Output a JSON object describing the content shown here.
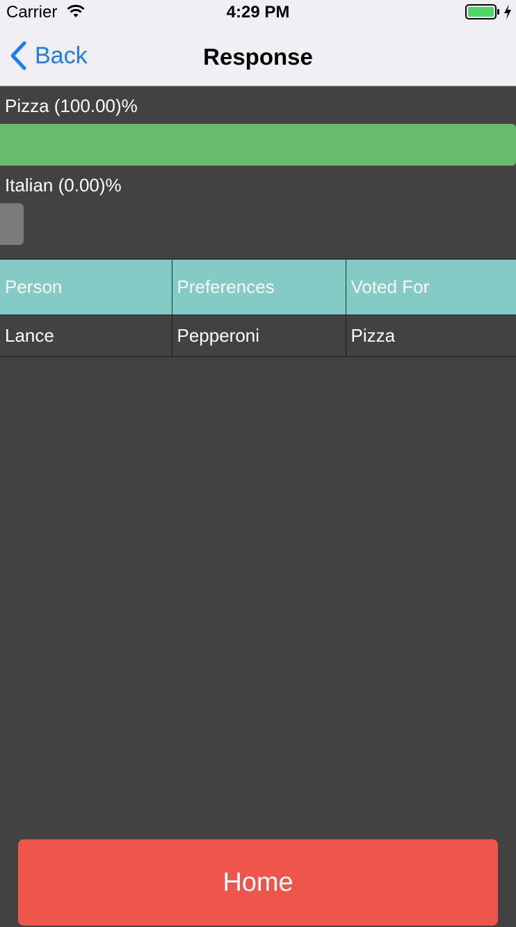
{
  "status_bar": {
    "carrier": "Carrier",
    "time": "4:29 PM",
    "icons": [
      "wifi-icon",
      "battery-icon",
      "charging-icon"
    ]
  },
  "nav": {
    "back_label": "Back",
    "title": "Response"
  },
  "results": [
    {
      "label": "Pizza (100.00)%",
      "percent": 100,
      "color": "#6aba6d"
    },
    {
      "label": "Italian (0.00)%",
      "percent": 0,
      "color": "#7b7b7b"
    }
  ],
  "table": {
    "header_color": "#83cbc4",
    "columns": [
      "Person",
      "Preferences",
      "Voted For"
    ],
    "rows": [
      [
        "Lance",
        "Pepperoni",
        "Pizza"
      ]
    ]
  },
  "home_button": {
    "label": "Home",
    "color": "#ef564b"
  },
  "colors": {
    "background": "#424242",
    "nav_background": "#efeff4",
    "link": "#1a7ff5"
  }
}
